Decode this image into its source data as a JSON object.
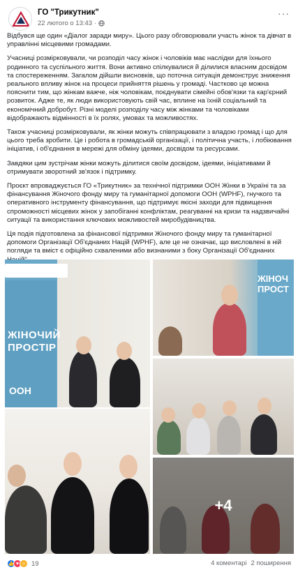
{
  "post": {
    "page_name": "ГО \"Трикутник\"",
    "timestamp": "22 лютого о 13:43",
    "separator": "·",
    "more_label": "···",
    "paragraphs": [
      "Відбувся ще один «Діалог заради миру». Цього разу обговорювали участь жінок та дівчат в управлінні місцевими громадами.",
      "Учасниці розмірковували, чи розподіл часу жінок і чоловіків має наслідки для їхнього родинного та суспільного життя. Вони активно спілкувалися й ділилися власним досвідом та спостереженням. Загалом дійшли висновків, що поточна ситуація демонструє зниження реального впливу жінок на процеси прийняття рішень у громаді. Частково це можна пояснити тим, що жінкам важче, ніж чоловікам, поєднувати сімейні обов'язки та кар'єрний розвиток. Адже те, як люди використовують свій час, вплине на їхній соціальний та економічний добробут. Різні моделі розподілу часу між жінками та чоловіками відображають відмінності в їх ролях, умовах та можливостях.",
      "Також учасниці розмірковували, як жінки можуть співпрацювати з владою громад і що для цього треба зробити. Це і робота в громадській організації, і політична участь, і лобіювання ініціатив, і об'єднання в мережі для обміну ідеями, досвідом та ресурсами.",
      "Завдяки цим зустрічам жінки можуть ділитися своїм досвідом, ідеями, ініціативами й отримувати зворотний зв'язок і підтримку.",
      "Проєкт впроваджується ГО «Трикутник» за технічної підтримки ООН Жінки в Україні та за фінансування Жіночого фонду миру та гуманітарної допомоги ООН (WPHF), гнучкого та оперативного інструменту фінансування, що підтримує якісні заходи для підвищення спроможності місцевих жінок у запобіганні конфліктам, реагуванні на кризи та надзвичайні ситуації та використання ключових можливостей миробудівництва.",
      "Ця подія підготовлена за фінансової підтримки Жіночого фонду миру та гуманітарної допомоги Організації Об'єднаних Націй (WPHF), але це не означає, що висловлені в ній погляди та вміст є офіційно схваленими або визнаними з боку Організації Об'єднаних Націй\"."
    ]
  },
  "photos": {
    "banner_text": "ЖІНОЧИЙ ПРОСТІР",
    "banner_logo": "ООН",
    "small_banner_text": "ЖІНОЧ ПРОСТ",
    "more_count": "+4"
  },
  "footer": {
    "reaction_count": "19",
    "comments": "4 коментарі",
    "shares": "2 поширення"
  },
  "colors": {
    "accent": "#1877f2",
    "banner": "#6aa9c9"
  }
}
